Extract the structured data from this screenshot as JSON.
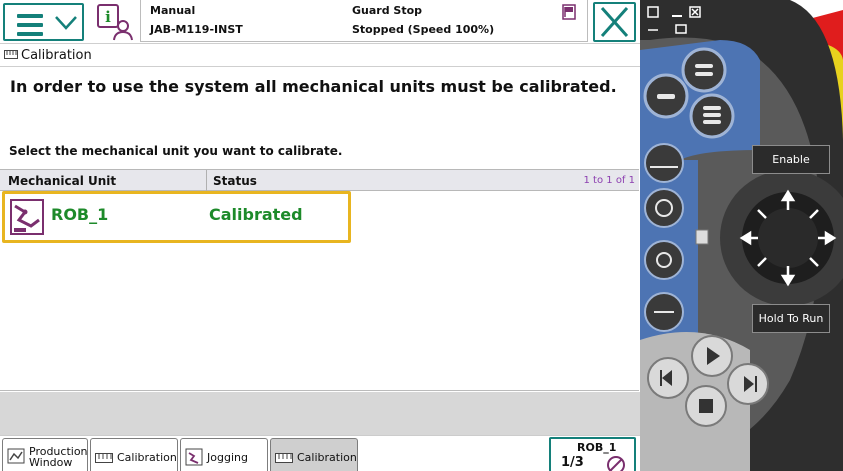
{
  "topbar": {
    "mode": "Manual",
    "system_name": "JAB-M119-INST",
    "guard": "Guard Stop",
    "run_state": "Stopped (Speed 100%)",
    "icons": [
      "menu-icon",
      "info-icon",
      "flag-icon",
      "close-icon"
    ]
  },
  "window": {
    "title": "Calibration"
  },
  "content": {
    "headline": "In order to use the system all mechanical units must be calibrated.",
    "instruction": "Select the mechanical unit you want to calibrate."
  },
  "table": {
    "columns": [
      "Mechanical Unit",
      "Status"
    ],
    "count": "1 to 1 of 1",
    "rows": [
      {
        "unit": "ROB_1",
        "status": "Calibrated"
      }
    ]
  },
  "taskbar": {
    "tasks": [
      {
        "label_line1": "Production",
        "label_line2": "Window",
        "selected": false
      },
      {
        "label": "Calibration",
        "selected": false
      },
      {
        "label": "Jogging",
        "selected": false
      },
      {
        "label": "Calibration",
        "selected": true
      }
    ],
    "robot": {
      "name": "ROB_1",
      "fraction": "1/3"
    }
  },
  "pendant": {
    "enable_label": "Enable",
    "hold_label": "Hold To Run"
  },
  "colors": {
    "accent": "#14807a",
    "calibrated": "#1d8a2a",
    "selection": "#e8b520",
    "count": "#8c3fb0",
    "pendant_blue": "#3e6fb5"
  }
}
